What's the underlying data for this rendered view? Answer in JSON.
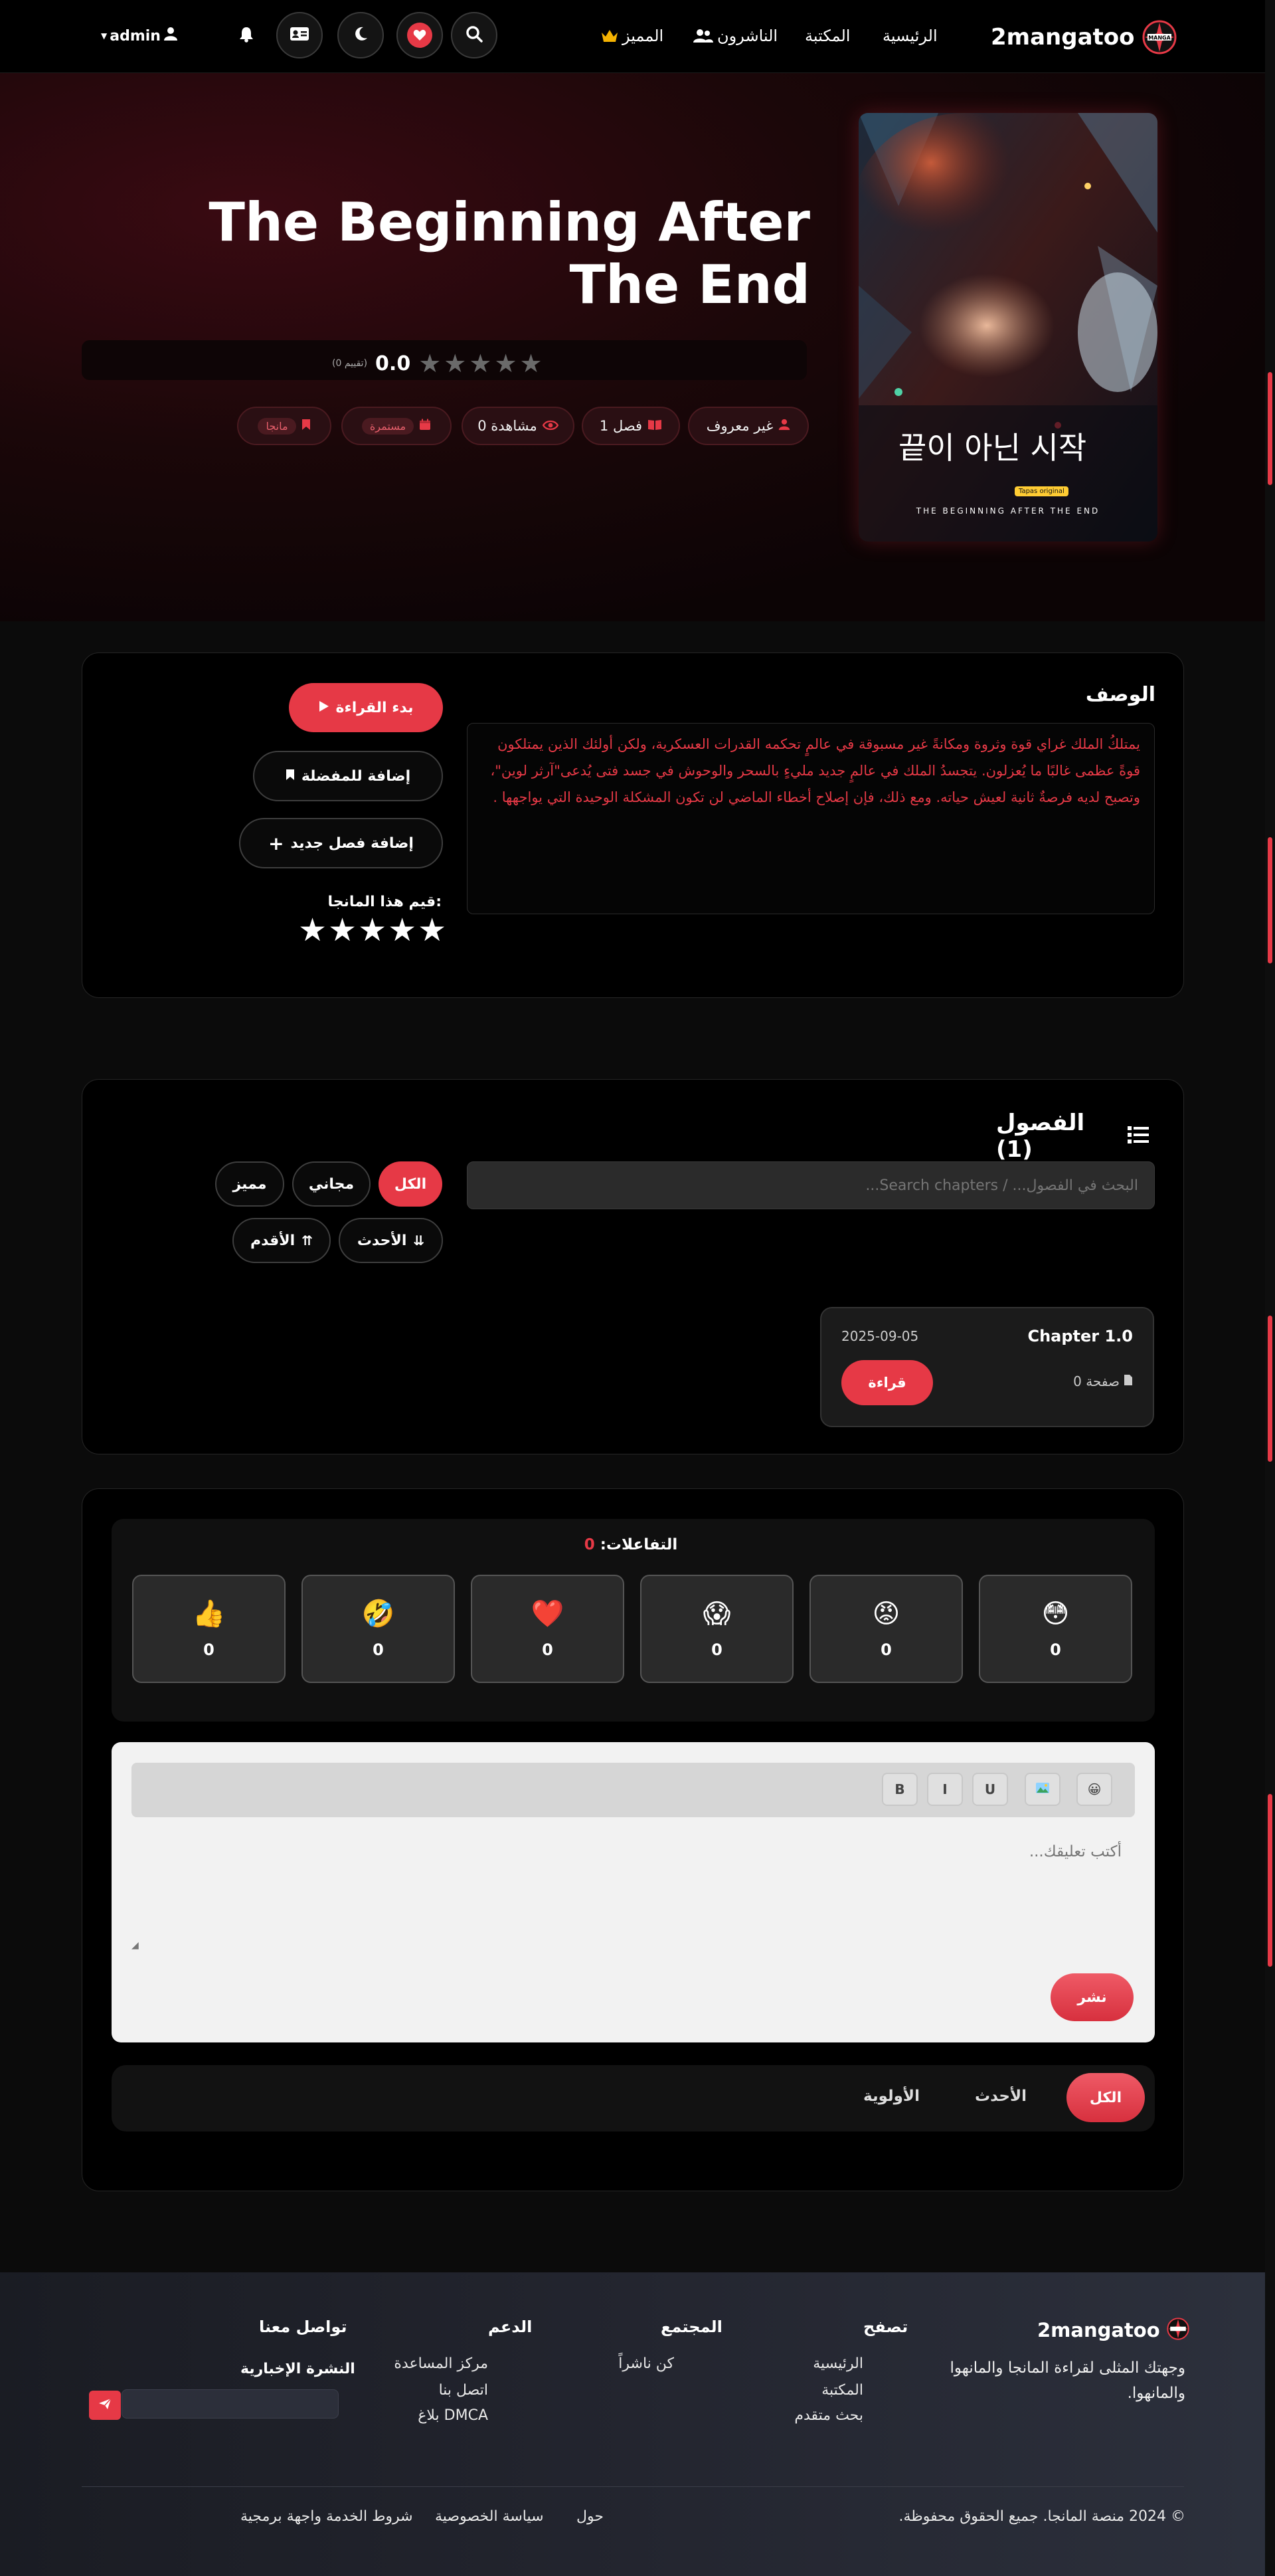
{
  "nav": {
    "brand": "2mangatoo",
    "links": [
      "الرئيسية",
      "المكتبة",
      "الناشرون",
      "المميز"
    ],
    "user": "admin"
  },
  "hero": {
    "title": "The Beginning After The End",
    "rating_value": "0.0",
    "rating_count": "(0 تقييم)",
    "rating_stars": 0,
    "cover_title_ko": "끝이 아닌 시작",
    "cover_subtitle": "THE BEGINNING AFTER THE END",
    "cover_badge": "Tapas original",
    "pills": {
      "author": "غير معروف",
      "chapters": "1 فصل",
      "views": "0 مشاهدة",
      "status": "مستمرة",
      "type": "مانجا"
    }
  },
  "description": {
    "heading": "الوصف",
    "text": "يمتلكُ الملك غراي قوة وثروة ومكانةً غير مسبوقة في عالمٍ تحكمه القدرات العسكرية، ولكن أولئك الذين يمتلكون قوةً عظمى غالبًا ما يُعزلون. يتجسدُ الملك في عالمٍ جديد مليءٍ بالسحر والوحوش في جسد فتى يُدعى\"آرثر لوين\"، وتصبح لديه فرصةٌ ثانية لعيش حياته. ومع ذلك، فإن إصلاح أخطاء الماضي لن تكون المشكلة الوحيدة التي يواجهها ."
  },
  "actions": {
    "start_reading": "بدء القراءة",
    "add_favorite": "إضافة للمفضلة",
    "add_chapter": "إضافة فصل جديد",
    "rate_label": "قيم هذا المانجا:"
  },
  "chapters": {
    "heading": "الفصول (1)",
    "search_placeholder": "البحث في الفصول... / Search chapters...",
    "filters": [
      "الكل",
      "مجاني",
      "مميز"
    ],
    "sort": [
      "الأحدث",
      "الأقدم"
    ],
    "items": [
      {
        "title": "Chapter 1.0",
        "date": "2025-09-05",
        "pages": "0 صفحة",
        "read_label": "قراءة"
      }
    ]
  },
  "reactions": {
    "label": "التفاعلات:",
    "total": "0",
    "items": [
      {
        "icon": "flushed-face-icon",
        "emoji": "😳",
        "count": "0"
      },
      {
        "icon": "angry-face-icon",
        "emoji": "😡",
        "count": "0"
      },
      {
        "icon": "screaming-face-icon",
        "emoji": "😱",
        "count": "0"
      },
      {
        "icon": "heart-icon",
        "emoji": "❤️",
        "count": "0"
      },
      {
        "icon": "rofl-face-icon",
        "emoji": "🤣",
        "count": "0"
      },
      {
        "icon": "thumbs-up-icon",
        "emoji": "👍",
        "count": "0"
      }
    ]
  },
  "comment": {
    "placeholder": "أكتب تعليقك...",
    "toolbar": [
      "B",
      "I",
      "U"
    ],
    "submit": "نشر",
    "tabs": [
      "الكل",
      "الأحدث",
      "الأولوية"
    ]
  },
  "footer": {
    "brand": "2mangatoo",
    "tagline": "وجهتك المثلى لقراءة المانجا والمانهوا والمانهوا.",
    "browse_head": "تصفح",
    "browse": [
      "الرئيسية",
      "المكتبة",
      "بحث متقدم"
    ],
    "community_head": "المجتمع",
    "community": [
      "كن ناشراً"
    ],
    "support_head": "الدعم",
    "support": [
      "مركز المساعدة",
      "اتصل بنا",
      "بلاغ DMCA"
    ],
    "contact_head": "تواصل معنا",
    "newsletter_head": "النشرة الإخبارية",
    "copyright": "© 2024 منصة المانجا. جميع الحقوق محفوظة.",
    "bottom_links": [
      "حول",
      "سياسة الخصوصية",
      "شروط الخدمة واجهة برمجية"
    ]
  },
  "colors": {
    "accent": "#e63946",
    "card": "#000000",
    "page": "#0b0b0b"
  }
}
